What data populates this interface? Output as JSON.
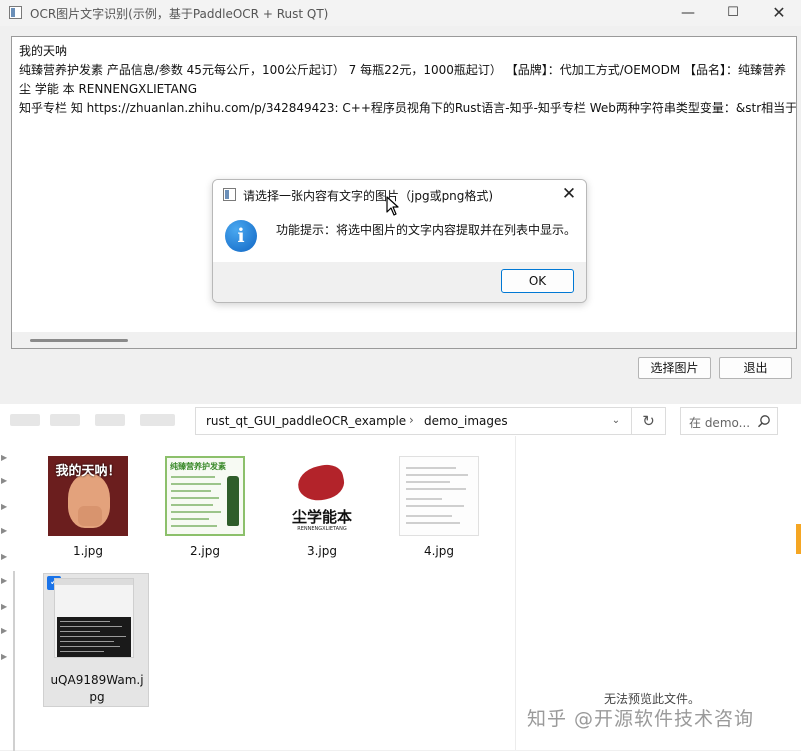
{
  "app": {
    "title": "OCR图片文字识别(示例，基于PaddleOCR + Rust QT)",
    "window_controls": {
      "minimize": "—",
      "maximize": "☐",
      "close": "✕"
    },
    "text_lines": [
      "我的天呐",
      "纯臻营养护发素 产品信息/参数 45元每公斤，100公斤起订） 7 每瓶22元，1000瓶起订） 【品牌】：代加工方式/OEMODM 【品名】：纯臻营养",
      "尘 学能 本 RENNENGXLIETANG",
      "知乎专栏 知 https://zhuanlan.zhihu.com/p/342849423: C++程序员视角下的Rust语言-知乎-知乎专栏 Web两种字符串类型变量：&str相当于c"
    ],
    "buttons": {
      "select_image": "选择图片",
      "exit": "退出"
    }
  },
  "dialog": {
    "title": "请选择一张内容有文字的图片（jpg或png格式)",
    "close": "✕",
    "info_glyph": "i",
    "message": "功能提示：将选中图片的文字内容提取并在列表中显示。",
    "ok_label": "OK"
  },
  "explorer": {
    "breadcrumb": [
      "rust_qt_GUI_paddleOCR_example",
      "demo_images"
    ],
    "breadcrumb_sep": "›",
    "addr_chevron": "⌄",
    "refresh": "↻",
    "search_placeholder": "在 demo...",
    "files": [
      {
        "name": "1.jpg",
        "caption": "我的天呐！"
      },
      {
        "name": "2.jpg",
        "caption": "纯臻营养护发素"
      },
      {
        "name": "3.jpg",
        "caption": "尘学能本",
        "sub": "RENNENGXLIETANG"
      },
      {
        "name": "4.jpg"
      },
      {
        "name_line1": "uQA9189Wam.j",
        "name_line2": "pg",
        "selected": true
      }
    ],
    "check_glyph": "✓",
    "preview_text": "无法预览此文件。",
    "watermark": "知乎 @开源软件技术咨询"
  },
  "colors": {
    "accent": "#0078d4",
    "selection": "#1a73e8",
    "info": "#1066c4"
  }
}
